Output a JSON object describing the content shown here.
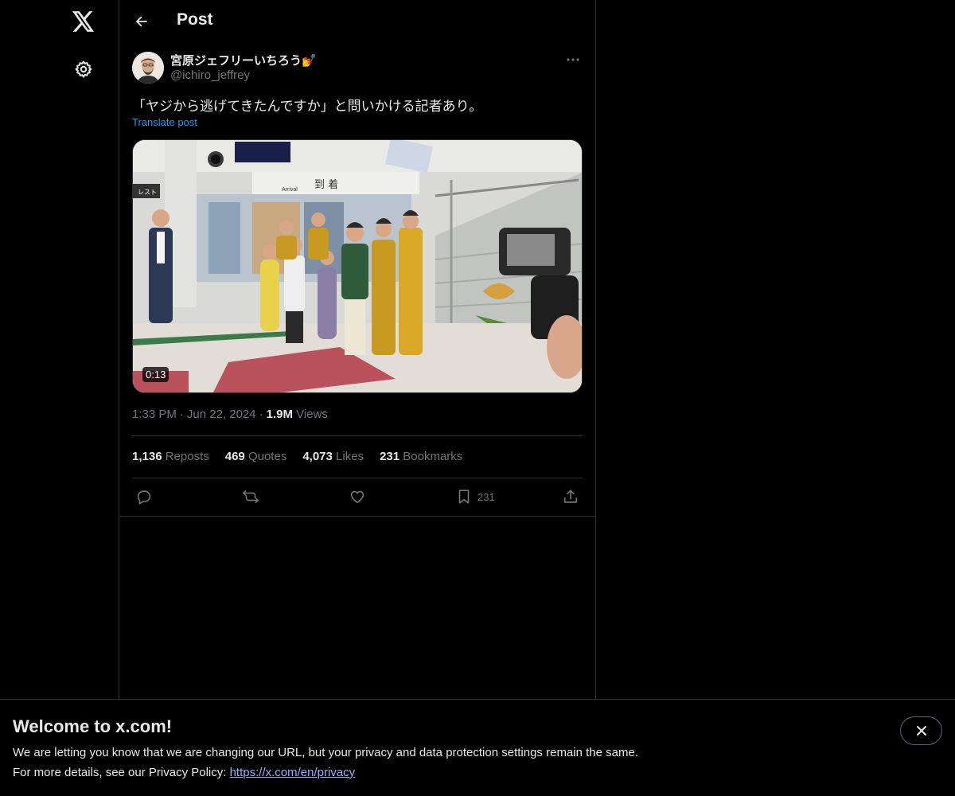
{
  "nav": {
    "logo_icon": "x-logo-icon",
    "settings_icon": "gear-icon"
  },
  "header": {
    "back_icon": "arrow-left-icon",
    "title": "Post"
  },
  "post": {
    "author_name": "宮原ジェフリーいちろう",
    "author_badge": "💅",
    "author_handle": "@ichiro_jeffrey",
    "text": "「ヤジから逃げてきたんですか」と問いかける記者あり。",
    "translate_label": "Translate post",
    "media": {
      "type": "video",
      "duration": "0:13",
      "sign_arrival_en": "Arrival",
      "sign_arrival_jp": "到 着",
      "sign_left": "レスト"
    },
    "time": "1:33 PM",
    "date": "Jun 22, 2024",
    "views_count": "1.9M",
    "views_label": "Views"
  },
  "stats": {
    "reposts_count": "1,136",
    "reposts_label": "Reposts",
    "quotes_count": "469",
    "quotes_label": "Quotes",
    "likes_count": "4,073",
    "likes_label": "Likes",
    "bookmarks_count": "231",
    "bookmarks_label": "Bookmarks"
  },
  "actions": {
    "reply_icon": "reply-icon",
    "repost_icon": "repost-icon",
    "like_icon": "heart-icon",
    "bookmark_icon": "bookmark-icon",
    "bookmark_count": "231",
    "share_icon": "share-icon"
  },
  "banner": {
    "title": "Welcome to x.com!",
    "line1": "We are letting you know that we are changing our URL, but your privacy and data protection settings remain the same.",
    "line2_prefix": "For more details, see our Privacy Policy: ",
    "link": "https://x.com/en/privacy",
    "close_icon": "close-icon"
  },
  "colors": {
    "background": "#000000",
    "text_primary": "#e7e9ea",
    "text_secondary": "#71767b",
    "accent": "#1d9bf0",
    "border": "#2f3336",
    "link": "#a6a8ff"
  }
}
